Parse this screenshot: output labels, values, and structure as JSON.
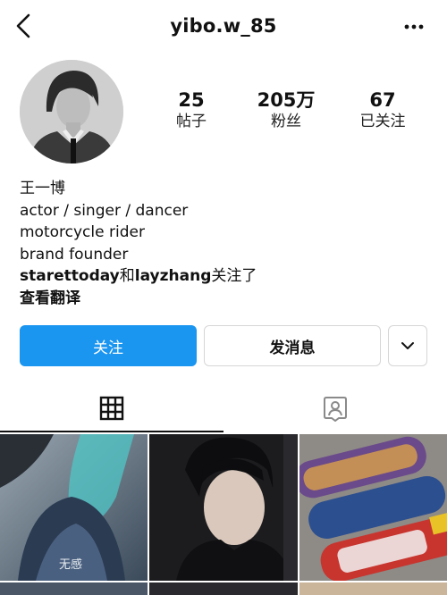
{
  "header": {
    "username": "yibo.w_85",
    "back_icon": "chevron-left-icon",
    "more_icon": "more-horizontal-icon"
  },
  "stats": {
    "posts": {
      "value": "25",
      "label": "帖子"
    },
    "followers": {
      "value": "205万",
      "label": "粉丝"
    },
    "following": {
      "value": "67",
      "label": "已关注"
    }
  },
  "bio": {
    "name": "王一博",
    "lines": [
      "actor / singer / dancer",
      "motorcycle rider",
      "brand founder"
    ],
    "followed_by": {
      "user1": "starettoday",
      "connector": "和",
      "user2": "layzhang",
      "suffix": "关注了"
    },
    "translate": "查看翻译"
  },
  "actions": {
    "follow": "关注",
    "message": "发消息",
    "more_icon": "chevron-down-icon"
  },
  "tabs": {
    "posts_icon": "grid-icon",
    "tagged_icon": "tagged-person-icon"
  },
  "grid": {
    "tile1_caption": "无感"
  },
  "colors": {
    "follow_button": "#1a95f0",
    "border": "#d6d6d6"
  }
}
